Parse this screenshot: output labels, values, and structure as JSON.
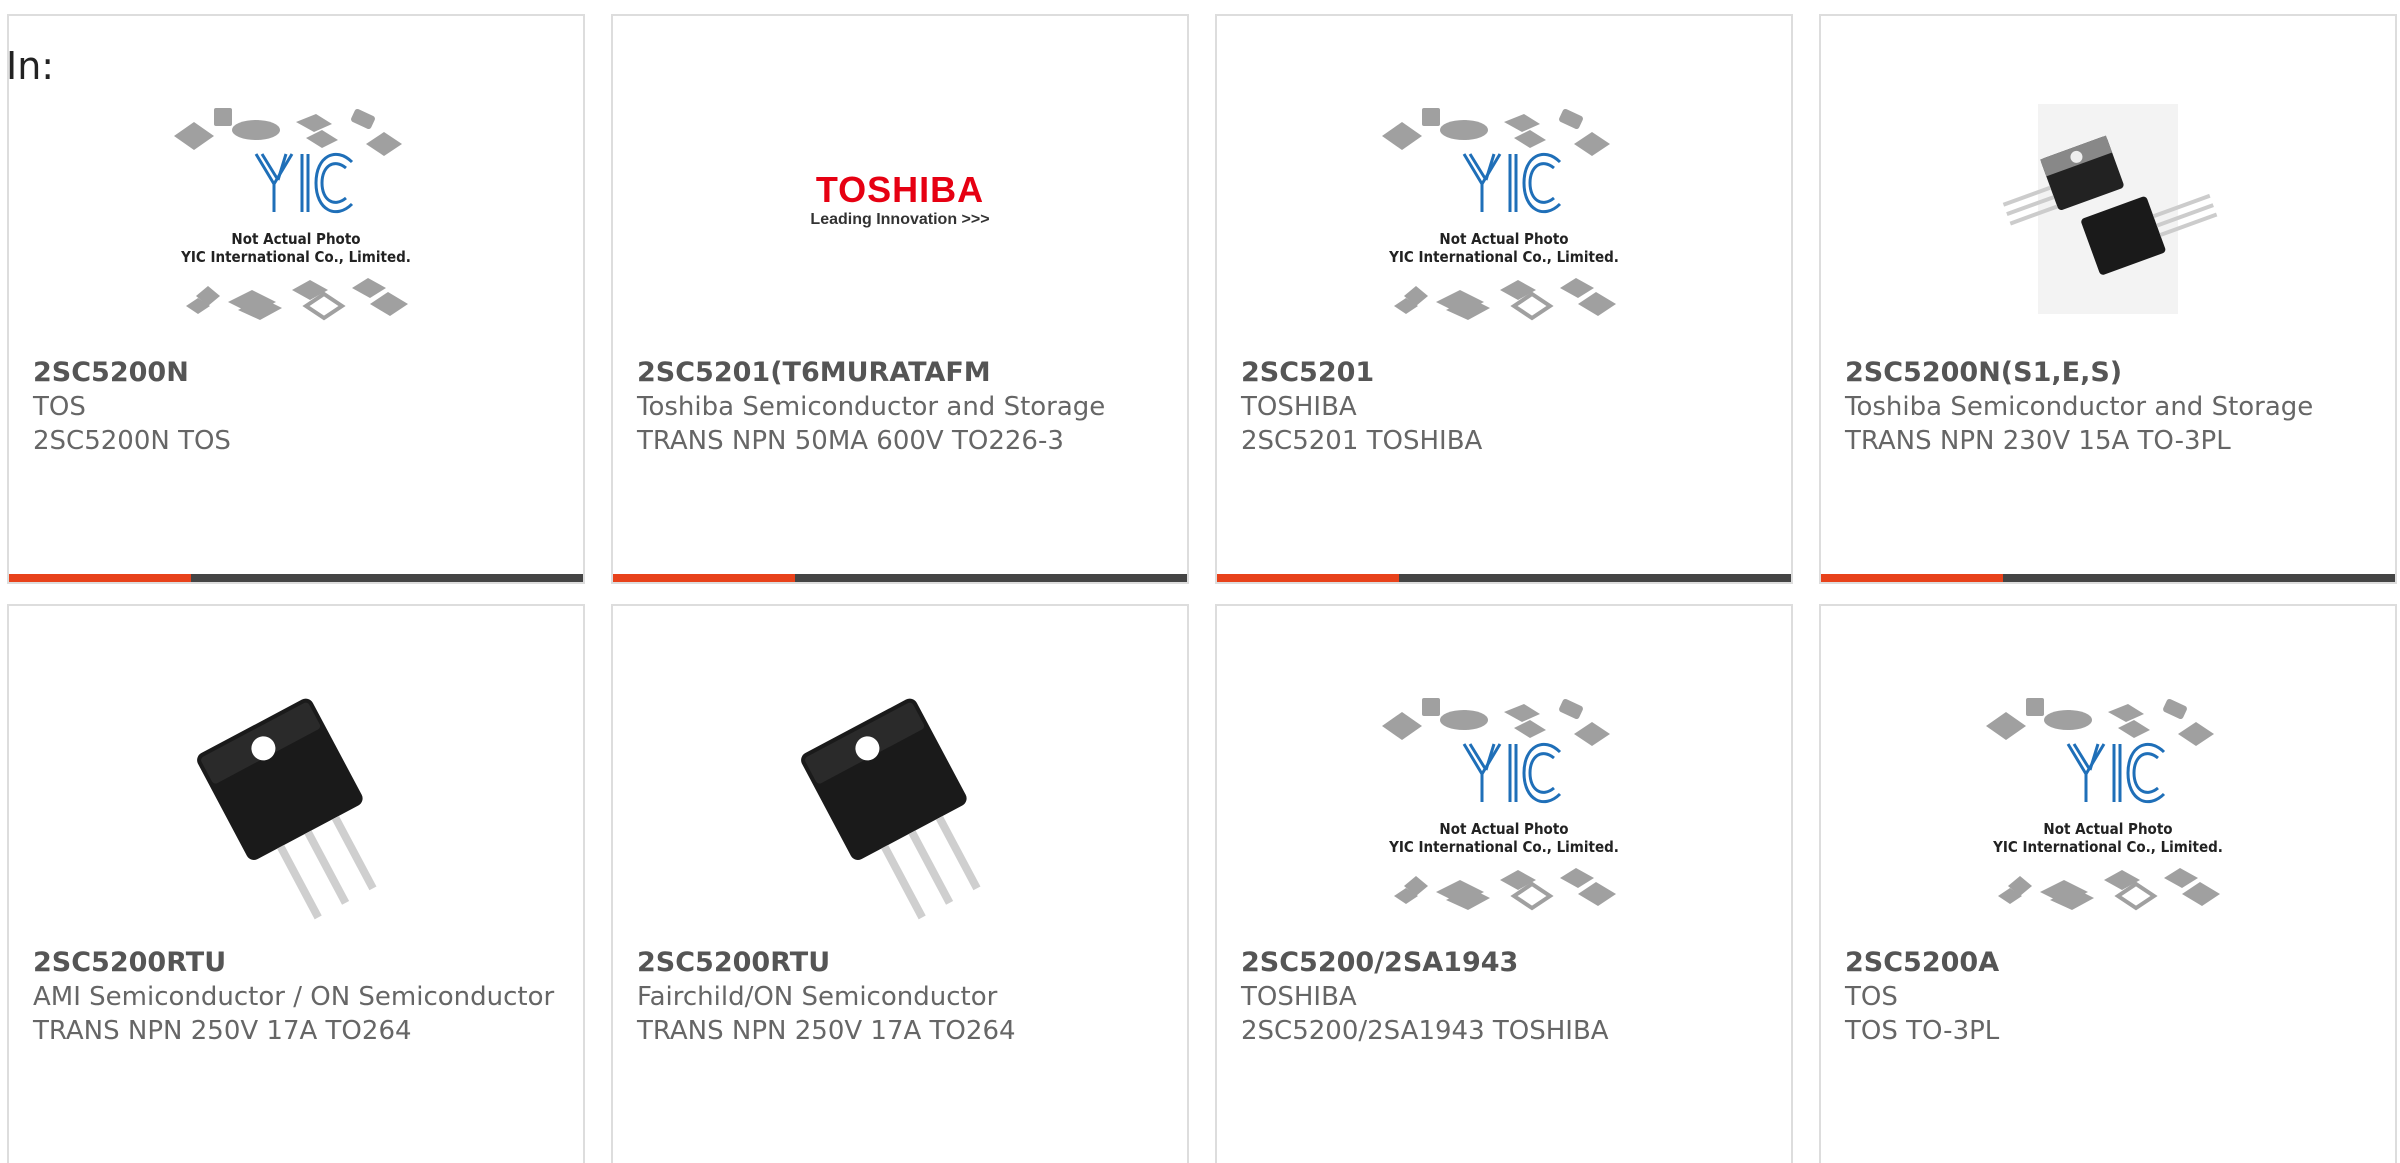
{
  "filter_label": "In:",
  "placeholder": {
    "logo": "YIC",
    "line1": "Not Actual Photo",
    "line2": "YIC International Co., Limited."
  },
  "toshiba_logo": {
    "brand": "TOSHIBA",
    "tagline": "Leading Innovation >>>"
  },
  "colors": {
    "accent": "#e8421b",
    "bar": "#444444",
    "border": "#dddddd",
    "toshiba_red": "#e60012",
    "yic_blue": "#1f6fb8"
  },
  "products": [
    {
      "part_number": "2SC5200N",
      "manufacturer": "TOS",
      "description": "2SC5200N TOS",
      "image": "not-actual-photo"
    },
    {
      "part_number": "2SC5201(T6MURATAFM",
      "manufacturer": "Toshiba Semiconductor and Storage",
      "description": "TRANS NPN 50MA 600V TO226-3",
      "image": "toshiba-logo"
    },
    {
      "part_number": "2SC5201",
      "manufacturer": "TOSHIBA",
      "description": "2SC5201 TOSHIBA",
      "image": "not-actual-photo"
    },
    {
      "part_number": "2SC5200N(S1,E,S)",
      "manufacturer": "Toshiba Semiconductor and Storage",
      "description": "TRANS NPN 230V 15A TO-3PL",
      "image": "transistor-pair-photo"
    },
    {
      "part_number": "2SC5200RTU",
      "manufacturer": "AMI Semiconductor / ON Semiconductor",
      "description": "TRANS NPN 250V 17A TO264",
      "image": "transistor-photo"
    },
    {
      "part_number": "2SC5200RTU",
      "manufacturer": "Fairchild/ON Semiconductor",
      "description": "TRANS NPN 250V 17A TO264",
      "image": "transistor-photo"
    },
    {
      "part_number": "2SC5200/2SA1943",
      "manufacturer": "TOSHIBA",
      "description": "2SC5200/2SA1943 TOSHIBA",
      "image": "not-actual-photo"
    },
    {
      "part_number": "2SC5200A",
      "manufacturer": "TOS",
      "description": "TOS TO-3PL",
      "image": "not-actual-photo"
    }
  ]
}
